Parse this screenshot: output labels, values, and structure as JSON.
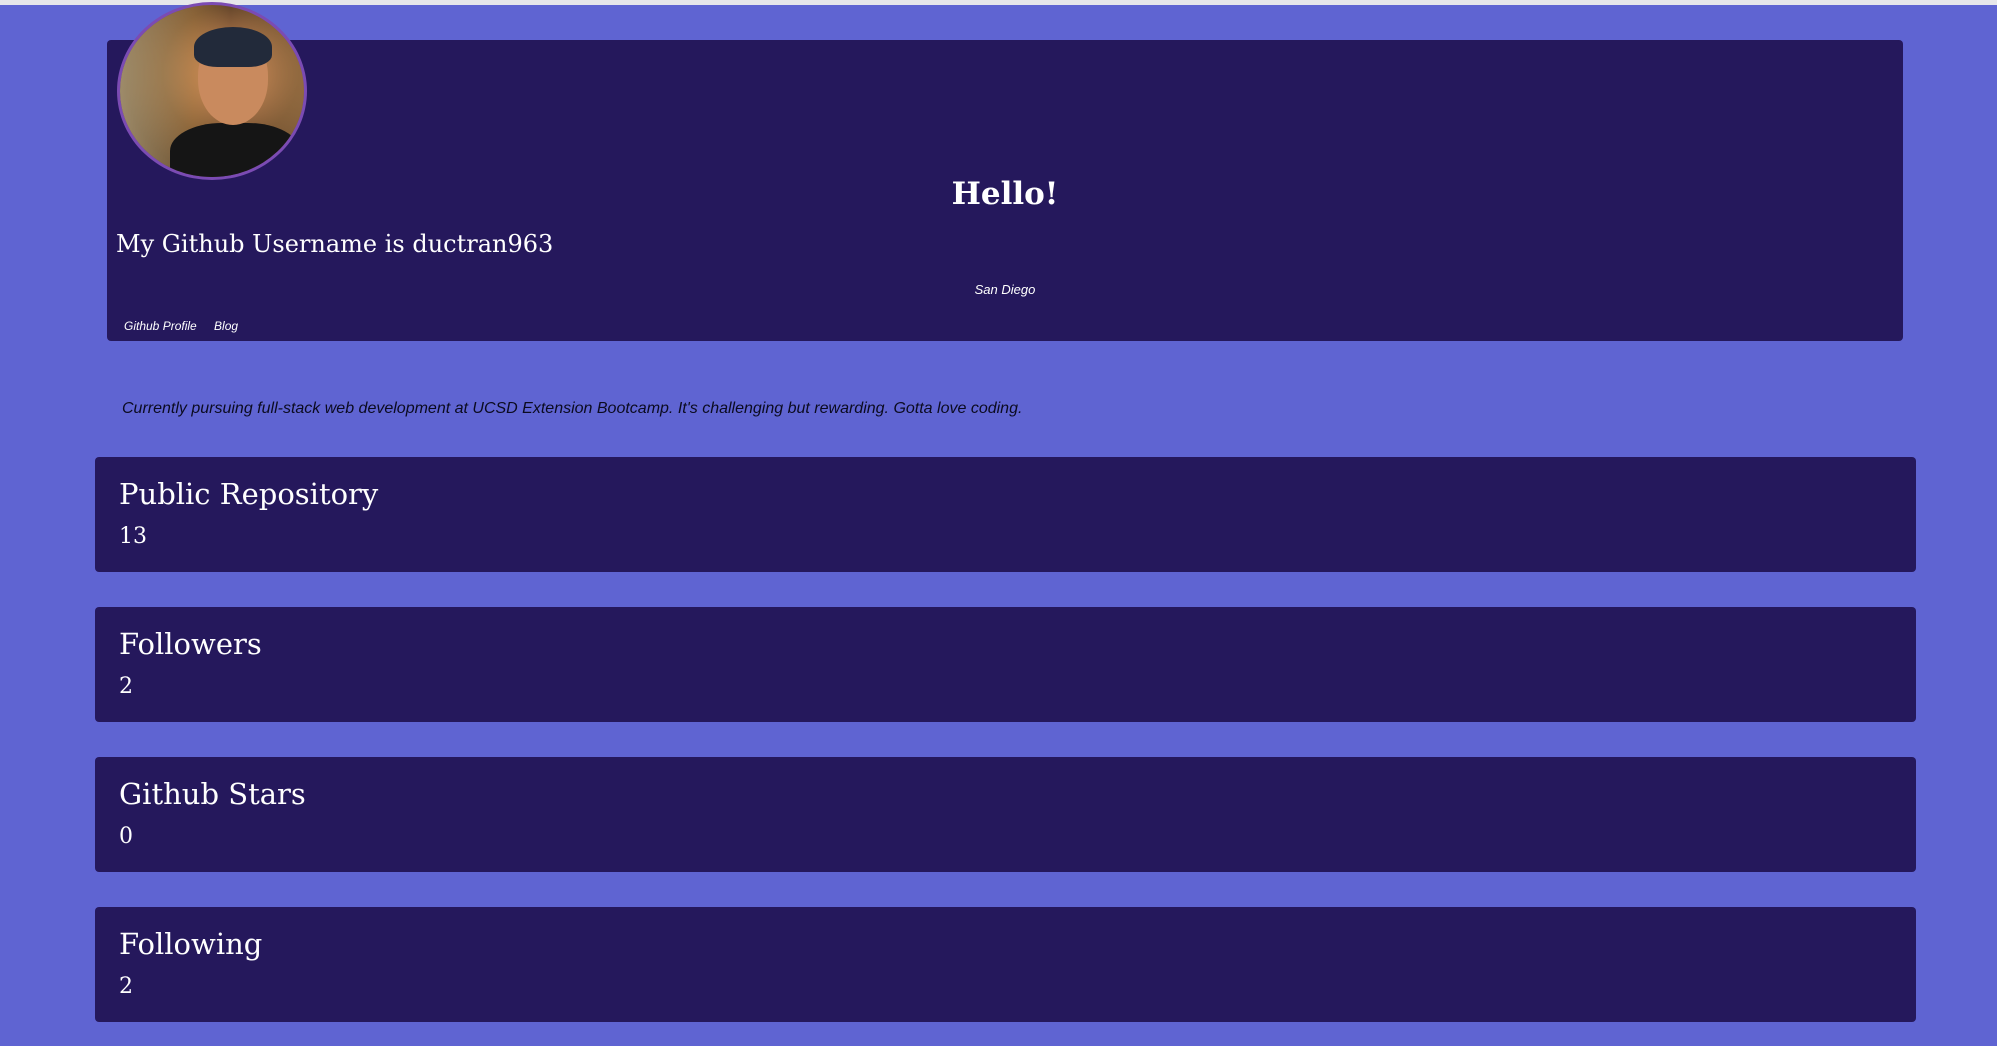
{
  "header": {
    "greeting": "Hello!",
    "username_line": "My Github Username is ductran963",
    "location": "San Diego",
    "links": [
      {
        "label": "Github Profile"
      },
      {
        "label": "Blog"
      }
    ]
  },
  "bio": "Currently pursuing full-stack web development at UCSD Extension Bootcamp. It's challenging but rewarding. Gotta love coding.",
  "stats": {
    "repos": {
      "label": "Public Repository",
      "value": "13"
    },
    "followers": {
      "label": "Followers",
      "value": "2"
    },
    "stars": {
      "label": "Github Stars",
      "value": "0"
    },
    "following": {
      "label": "Following",
      "value": "2"
    }
  },
  "colors": {
    "page_background": "#5f64d2",
    "card_background": "#25185c",
    "text_light": "#ffffff",
    "avatar_border": "#7b4bb3"
  }
}
